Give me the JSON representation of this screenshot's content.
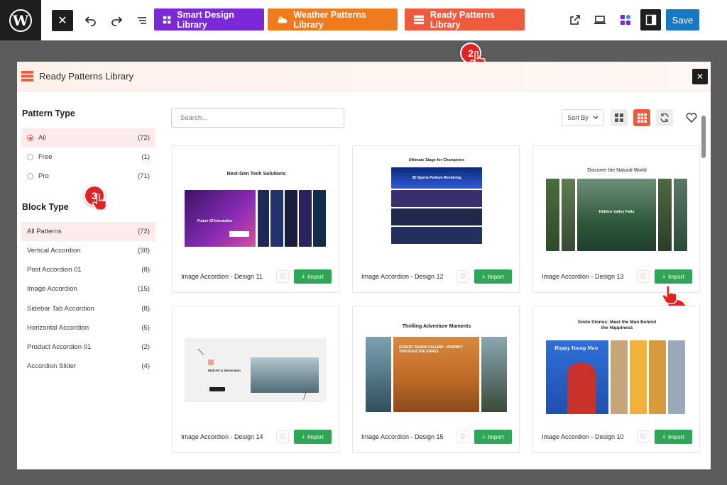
{
  "toolbar": {
    "close_label": "✕",
    "libraries": [
      {
        "label": "Smart Design Library",
        "color": "#7b28d8"
      },
      {
        "label": "Weather Patterns Library",
        "color": "#f07a1e"
      },
      {
        "label": "Ready Patterns Library",
        "color": "#ef5a3c"
      }
    ],
    "save_label": "Save"
  },
  "steps": [
    "2",
    "3",
    "4"
  ],
  "modal": {
    "title": "Ready Patterns Library",
    "close_label": "✕",
    "search_placeholder": "Search...",
    "sort_label": "Sort By"
  },
  "sidebar": {
    "pattern_type_heading": "Pattern Type",
    "pattern_types": [
      {
        "label": "All",
        "count": "(72)",
        "selected": true
      },
      {
        "label": "Free",
        "count": "(1)",
        "selected": false
      },
      {
        "label": "Pro",
        "count": "(71)",
        "selected": false
      }
    ],
    "block_type_heading": "Block Type",
    "block_types": [
      {
        "label": "All Patterns",
        "count": "(72)"
      },
      {
        "label": "Vertical Accordion",
        "count": "(30)"
      },
      {
        "label": "Post Accordion 01",
        "count": "(8)"
      },
      {
        "label": "Image Accordion",
        "count": "(15)"
      },
      {
        "label": "Sidebar Tab Accordion",
        "count": "(8)"
      },
      {
        "label": "Horizontal Accordion",
        "count": "(5)"
      },
      {
        "label": "Product Accordion 01",
        "count": "(2)"
      },
      {
        "label": "Accordion Slider",
        "count": "(4)"
      }
    ]
  },
  "cards": [
    {
      "name": "Image Accordion - Design 11",
      "preview_title": "Next-Gen Tech Solutions",
      "import_label": "Import"
    },
    {
      "name": "Image Accordion - Design 12",
      "preview_title": "Ultimate Stage for Champions",
      "import_label": "Import"
    },
    {
      "name": "Image Accordion - Design 13",
      "preview_title": "Discover the Natural World",
      "import_label": "Import"
    },
    {
      "name": "Image Accordion - Design 14",
      "preview_title": "",
      "import_label": "Import"
    },
    {
      "name": "Image Accordion - Design 15",
      "preview_title": "Thrilling Adventure Moments",
      "import_label": "Import"
    },
    {
      "name": "Image Accordion - Design 10",
      "preview_title": "Smile Stories: Meet the Man Behind the Happiness",
      "import_label": "Import"
    }
  ],
  "preview_texts": {
    "tech_inner": "Future Of Interaction",
    "sports_inner": "3D Sports Podium Rendering",
    "nature_inner": "Hidden Valley Falls",
    "wall_inner": "Wall Art & Decoration",
    "desert_inner": "DESERT SANDS CALLING: JOURNEY THROUGH THE DUNES",
    "smile_inner": "Happy Young Man"
  },
  "colors": {
    "accent": "#ef5a3c",
    "import_green": "#2ea655",
    "save_blue": "#1779c4"
  }
}
